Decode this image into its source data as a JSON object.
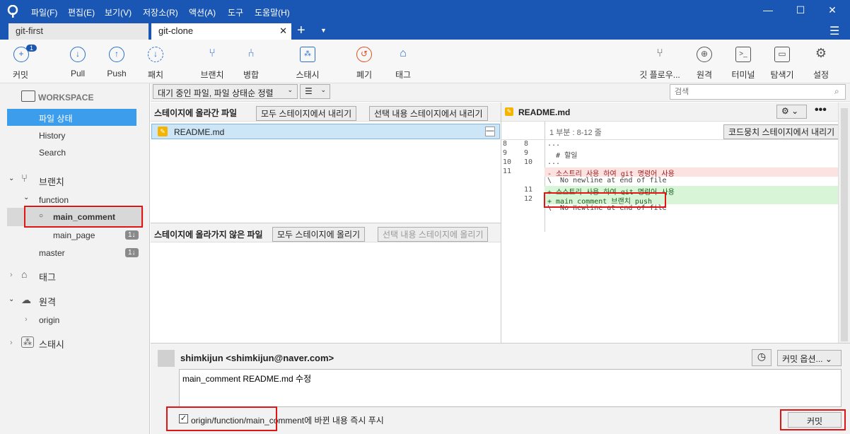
{
  "titlebar": {
    "menus": [
      "파일(F)",
      "편집(E)",
      "보기(V)",
      "저장소(R)",
      "액션(A)",
      "도구",
      "도움말(H)"
    ]
  },
  "tabs": [
    {
      "label": "git-first"
    },
    {
      "label": "git-clone"
    }
  ],
  "toolbar": {
    "commit": "커밋",
    "commit_badge": "1",
    "pull": "Pull",
    "push": "Push",
    "fetch": "패치",
    "branch": "브랜치",
    "merge": "병합",
    "stash": "스태시",
    "discard": "폐기",
    "tag": "태그",
    "gitflow": "깃 플로우...",
    "remote": "원격",
    "terminal": "터미널",
    "explorer": "탐색기",
    "settings": "설정"
  },
  "sidebar": {
    "workspace": "WORKSPACE",
    "file_status": "파일 상태",
    "history": "History",
    "search": "Search",
    "branches": "브랜치",
    "function_folder": "function",
    "main_comment": "main_comment",
    "main_page": "main_page",
    "main_page_badge": "1↓",
    "master": "master",
    "master_badge": "1↓",
    "tags": "태그",
    "remotes": "원격",
    "origin": "origin",
    "stashes": "스태시"
  },
  "filter": {
    "sort_label": "대기 중인 파일, 파일 상태순 정렬",
    "view_label": "☰",
    "search_placeholder": "검색"
  },
  "staged": {
    "title": "스테이지에 올라간 파일",
    "unstage_all": "모두 스테이지에서 내리기",
    "unstage_selected": "선택 내용 스테이지에서 내리기",
    "files": [
      {
        "name": "README.md"
      }
    ]
  },
  "unstaged": {
    "title": "스테이지에 올라가지 않은 파일",
    "stage_all": "모두 스테이지에 올리기",
    "stage_selected": "선택 내용 스테이지에 올리기"
  },
  "diff": {
    "file": "README.md",
    "hunk_header": "1 부분 : 8-12 줄",
    "hunk_button": "코드뭉치 스테이지에서 내리기",
    "lines": [
      {
        "old": "8",
        "new": "8",
        "type": "ctx",
        "text": "..."
      },
      {
        "old": "9",
        "new": "9",
        "type": "ctx",
        "text": "  # 할일"
      },
      {
        "old": "10",
        "new": "10",
        "type": "ctx",
        "text": "..."
      },
      {
        "old": "11",
        "new": "",
        "type": "del",
        "text": "- 소스트리 사용 하여 git 명령어 사용"
      },
      {
        "old": "",
        "new": "",
        "type": "ctx",
        "text": "\\  No newline at end of file"
      },
      {
        "old": "",
        "new": "11",
        "type": "add",
        "text": "+ 소스트리 사용 하여 git 명령어 사용"
      },
      {
        "old": "",
        "new": "12",
        "type": "add",
        "text": "+ main_comment 브랜치 push"
      },
      {
        "old": "",
        "new": "",
        "type": "ctx",
        "text": "\\  No newline at end of file"
      }
    ]
  },
  "commit": {
    "author": "shimkijun <shimkijun@naver.com>",
    "message": "main_comment README.md 수정",
    "push_checkbox_label": "origin/function/main_comment에 바뀐 내용 즉시 푸시",
    "options": "커밋 옵션...",
    "commit_button": "커밋"
  }
}
